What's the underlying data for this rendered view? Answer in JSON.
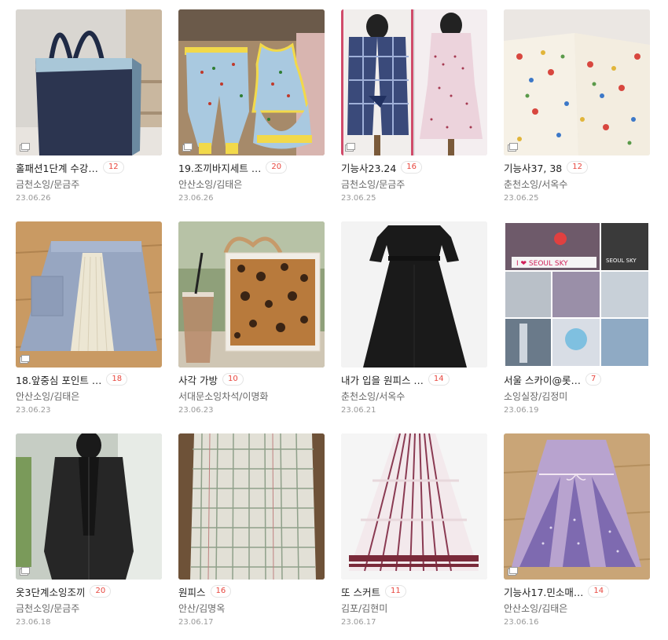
{
  "posts": [
    {
      "title": "홀패션1단계 수강…",
      "comments": "12",
      "author": "금천소잉/문금주",
      "date": "23.06.26"
    },
    {
      "title": "19.조끼바지세트 …",
      "comments": "20",
      "author": "안산소잉/김태은",
      "date": "23.06.26"
    },
    {
      "title": "기능사23.24",
      "comments": "16",
      "author": "금천소잉/문금주",
      "date": "23.06.25"
    },
    {
      "title": "기능사37, 38",
      "comments": "12",
      "author": "춘천소잉/서옥수",
      "date": "23.06.25"
    },
    {
      "title": "18.앞중심 포인트 …",
      "comments": "18",
      "author": "안산소잉/김태은",
      "date": "23.06.23"
    },
    {
      "title": "사각 가방",
      "comments": "10",
      "author": "서대문소잉차석/이명화",
      "date": "23.06.23"
    },
    {
      "title": "내가 입을 원피스 …",
      "comments": "14",
      "author": "춘천소잉/서옥수",
      "date": "23.06.21"
    },
    {
      "title": "서울 스카이@롯…",
      "comments": "7",
      "author": "소잉실장/김정미",
      "date": "23.06.19",
      "photo_text": {
        "sign1": "I ❤ SEOUL SKY",
        "sign2": "SEOUL SKY"
      }
    },
    {
      "title": "옷3단계소잉조끼",
      "comments": "20",
      "author": "금천소잉/문금주",
      "date": "23.06.18"
    },
    {
      "title": "원피스",
      "comments": "16",
      "author": "안산/김명옥",
      "date": "23.06.17"
    },
    {
      "title": "또 스커트",
      "comments": "11",
      "author": "김포/김현미",
      "date": "23.06.17"
    },
    {
      "title": "기능사17.민소매…",
      "comments": "14",
      "author": "안산소잉/김태은",
      "date": "23.06.16"
    }
  ],
  "icons": {
    "multi_image": "multi-image-icon"
  }
}
